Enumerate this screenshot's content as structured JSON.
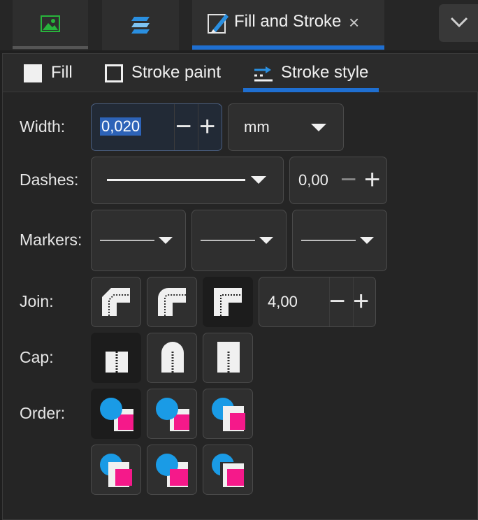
{
  "dock": {
    "tabs": [
      {
        "icon": "image-icon"
      },
      {
        "icon": "layers-icon"
      },
      {
        "icon": "fill-stroke-icon",
        "label": "Fill and Stroke",
        "close": "×"
      }
    ],
    "more_icon": "chevron-down-icon"
  },
  "subtabs": {
    "fill": "Fill",
    "stroke_paint": "Stroke paint",
    "stroke_style": "Stroke style"
  },
  "width": {
    "label": "Width:",
    "value": "0,020",
    "unit": "mm",
    "minus": "−",
    "plus": "+"
  },
  "dashes": {
    "label": "Dashes:",
    "offset": "0,00",
    "minus": "−",
    "plus": "+"
  },
  "markers": {
    "label": "Markers:"
  },
  "join": {
    "label": "Join:",
    "options": [
      "bevel-join-icon",
      "round-join-icon",
      "miter-join-icon"
    ],
    "selected": 2,
    "miter_limit": "4,00",
    "minus": "−",
    "plus": "+"
  },
  "cap": {
    "label": "Cap:",
    "options": [
      "butt-cap-icon",
      "round-cap-icon",
      "square-cap-icon"
    ],
    "selected": 0
  },
  "order": {
    "label": "Order:",
    "selected": 0
  },
  "colors": {
    "accent": "#1f6fd1",
    "marker_blue": "#1a9be6",
    "fill_pink": "#f5198a"
  }
}
